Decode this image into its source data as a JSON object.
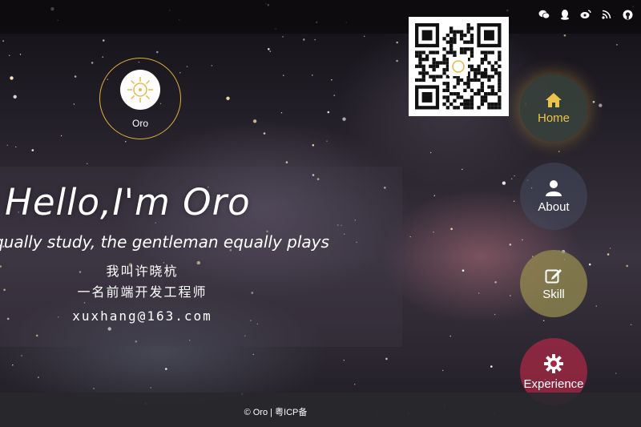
{
  "header": {
    "social_icons": [
      "wechat-icon",
      "qq-icon",
      "weibo-icon",
      "rss-icon",
      "github-icon"
    ]
  },
  "profile": {
    "name": "Oro"
  },
  "hero": {
    "greeting": "Hello,I'm Oro",
    "motto": "qually study, the gentleman equally plays",
    "intro_line1": "我叫许晓杭",
    "intro_line2": "一名前端开发工程师",
    "email": "xuxhang@163.com"
  },
  "nav": {
    "items": [
      {
        "label": "Home",
        "icon": "home-icon",
        "active": true
      },
      {
        "label": "About",
        "icon": "user-icon"
      },
      {
        "label": "Skill",
        "icon": "edit-icon"
      },
      {
        "label": "Experience",
        "icon": "gear-icon"
      }
    ]
  },
  "footer": {
    "text": "© Oro | 粤ICP备"
  },
  "colors": {
    "accent": "#ecc34a",
    "home_bg": "#37413c",
    "skill_bg": "#968c50",
    "experience_bg": "#aa2846"
  }
}
